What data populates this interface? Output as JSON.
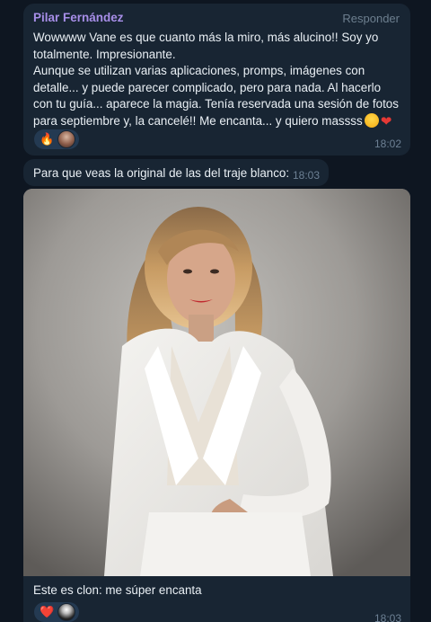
{
  "messages": [
    {
      "sender": "Pilar Fernández",
      "reply_label": "Responder",
      "text": "Wowwww Vane es que cuanto más la miro, más alucino!! Soy yo totalmente. Impresionante.\nAunque se utilizan varias aplicaciones, promps, imágenes con detalle... y puede parecer complicado, pero para nada. Al hacerlo con tu guía... aparece la magia. Tenía reservada una sesión de fotos para septiembre y, la cancelé!! Me encanta... y quiero massss",
      "trailing_emojis": [
        "smiling-face-icon",
        "red-heart-icon",
        "grinning-face-icon"
      ],
      "reactions": [
        "🔥"
      ],
      "time": "18:02"
    },
    {
      "text": "Para que veas la original de las del traje blanco:",
      "time": "18:03"
    },
    {
      "photo_subject": "woman in white suit",
      "caption": "Este es clon: me súper encanta",
      "reactions": [
        "❤️"
      ],
      "time": "18:03"
    }
  ],
  "colors": {
    "background": "#0e1621",
    "bubble": "#182533",
    "sender": "#a78ee8",
    "meta": "#6d8094"
  }
}
